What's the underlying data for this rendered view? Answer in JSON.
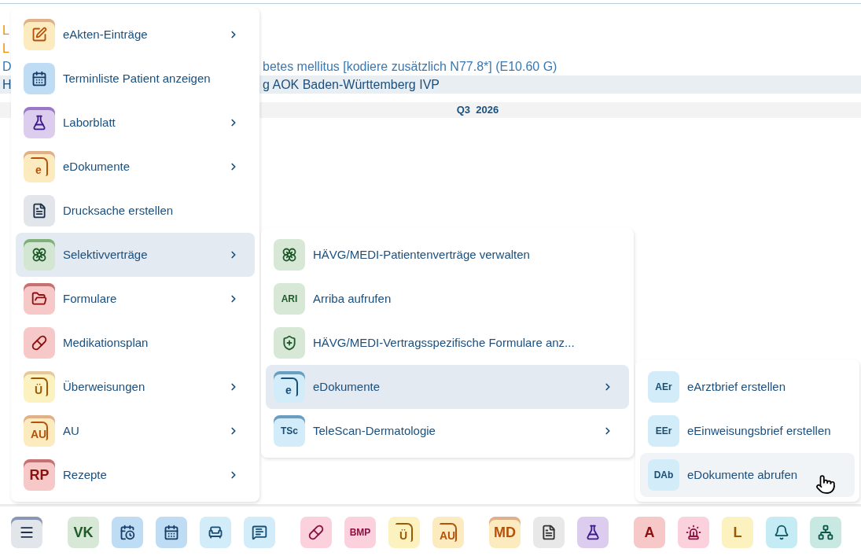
{
  "background": {
    "lines": [
      {
        "kind": "warning",
        "start": "L"
      },
      {
        "kind": "warning",
        "start": "L"
      },
      {
        "kind": "diagnosis",
        "start": "D",
        "end": "betes mellitus [kodiere zusätzlich N77.8*] (E10.60 G)"
      },
      {
        "kind": "contract",
        "start": "H",
        "end": "g AOK Baden-Württemberg IVP"
      }
    ],
    "quarter": "Q3  2026"
  },
  "main_menu": {
    "items": [
      {
        "label": "eAkten-Einträge",
        "has_submenu": true,
        "selected": false,
        "color": "#fdebc0"
      },
      {
        "label": "Terminliste Patient anzeigen",
        "has_submenu": false,
        "selected": false,
        "color": "#bfdcf5"
      },
      {
        "label": "Laborblatt",
        "has_submenu": true,
        "selected": false,
        "color": "#dccdee"
      },
      {
        "label": "eDokumente",
        "has_submenu": true,
        "selected": false,
        "color": "#fdebc0",
        "badge": "e",
        "kind": "document"
      },
      {
        "label": "Drucksache erstellen",
        "has_submenu": false,
        "selected": false,
        "color": "#e2e6ea"
      },
      {
        "label": "Selektivverträge",
        "has_submenu": true,
        "selected": true,
        "color": "#d3e6d2"
      },
      {
        "label": "Formulare",
        "has_submenu": true,
        "selected": false,
        "color": "#f6c8c8"
      },
      {
        "label": "Medikationsplan",
        "has_submenu": false,
        "selected": false,
        "color": "#f6c8c8"
      },
      {
        "label": "Überweisungen",
        "has_submenu": true,
        "selected": false,
        "color": "#fbf2c0",
        "badge": "Ü",
        "kind": "document"
      },
      {
        "label": "AU",
        "has_submenu": true,
        "selected": false,
        "color": "#fdebc0",
        "badge": "AU",
        "kind": "document"
      },
      {
        "label": "Rezepte",
        "has_submenu": true,
        "selected": false,
        "color": "#f6c8c8",
        "badge": "RP",
        "kind": "plain"
      }
    ]
  },
  "submenu": {
    "items": [
      {
        "label": "HÄVG/MEDI-Patientenverträge verwalten",
        "has_submenu": false,
        "selected": false,
        "color": "#d8e8d6"
      },
      {
        "label": "Arriba aufrufen",
        "has_submenu": false,
        "selected": false,
        "color": "#d8e8d6",
        "badge": "ARI",
        "kind": "plain"
      },
      {
        "label": "HÄVG/MEDI-Vertragsspezifische Formulare anz...",
        "has_submenu": false,
        "selected": false,
        "color": "#d8e8d6"
      },
      {
        "label": "eDokumente",
        "has_submenu": true,
        "selected": true,
        "color": "#d2ecf9",
        "badge": "e",
        "kind": "document"
      },
      {
        "label": "TeleScan-Dermatologie",
        "has_submenu": true,
        "selected": false,
        "color": "#d2ecf9",
        "badge": "TSc",
        "kind": "plain"
      }
    ]
  },
  "submenu_2": {
    "items": [
      {
        "label": "eArztbrief erstellen",
        "has_submenu": false,
        "selected": false,
        "color": "#d2ecf9",
        "badge": "AEr",
        "kind": "plain"
      },
      {
        "label": "eEinweisungsbrief erstellen",
        "has_submenu": false,
        "selected": false,
        "color": "#d2ecf9",
        "badge": "EEr",
        "kind": "plain"
      },
      {
        "label": "eDokumente abrufen",
        "has_submenu": false,
        "selected": true,
        "color": "#d2ecf9",
        "badge": "DAb",
        "kind": "plain"
      }
    ]
  },
  "toolbar": {
    "groups": [
      [
        {
          "has_submenu": true,
          "color": "#e2e6ea"
        }
      ],
      [
        {
          "has_submenu": false,
          "color": "#d8e8d6",
          "badge": "VK",
          "kind": "plain"
        },
        {
          "has_submenu": false,
          "color": "#bfdcf5"
        },
        {
          "has_submenu": false,
          "color": "#bfdcf5"
        },
        {
          "has_submenu": false,
          "color": "#d2ecf9"
        },
        {
          "has_submenu": false,
          "color": "#d2ecf9"
        }
      ],
      [
        {
          "has_submenu": false,
          "color": "#fad1dc"
        },
        {
          "has_submenu": false,
          "color": "#fad1dc",
          "badge": "BMP",
          "kind": "plain"
        },
        {
          "has_submenu": false,
          "color": "#fbf2c0",
          "badge": "Ü",
          "kind": "document"
        },
        {
          "has_submenu": false,
          "color": "#fdebc0",
          "badge": "AU",
          "kind": "document"
        }
      ],
      [
        {
          "has_submenu": true,
          "color": "#fdebc0",
          "badge": "MD",
          "kind": "plain"
        },
        {
          "has_submenu": false,
          "color": "#e8e8e8"
        },
        {
          "has_submenu": false,
          "color": "#dccdee"
        }
      ],
      [
        {
          "has_submenu": false,
          "color": "#f6c8c8",
          "badge": "A",
          "kind": "plain"
        },
        {
          "has_submenu": false,
          "color": "#fad1dc"
        },
        {
          "has_submenu": false,
          "color": "#fbf2c0",
          "badge": "L",
          "kind": "plain"
        },
        {
          "has_submenu": false,
          "color": "#c5ecf5"
        },
        {
          "has_submenu": false,
          "color": "#c8e8e2"
        }
      ]
    ]
  }
}
